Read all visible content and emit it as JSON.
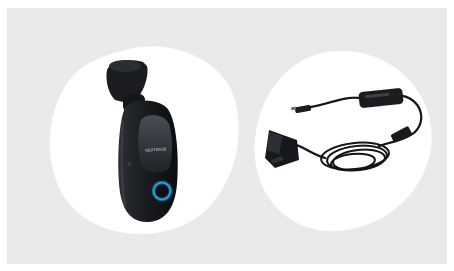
{
  "panels": [
    {
      "product": "dash-cam",
      "logo_text": "NEXTBASE"
    },
    {
      "product": "obd-hardwire-cable"
    }
  ],
  "colors": {
    "background": "#eaeaea",
    "blob": "#ffffff",
    "device_body": "#1b1d20",
    "accent_ring": "#29b6f6"
  }
}
